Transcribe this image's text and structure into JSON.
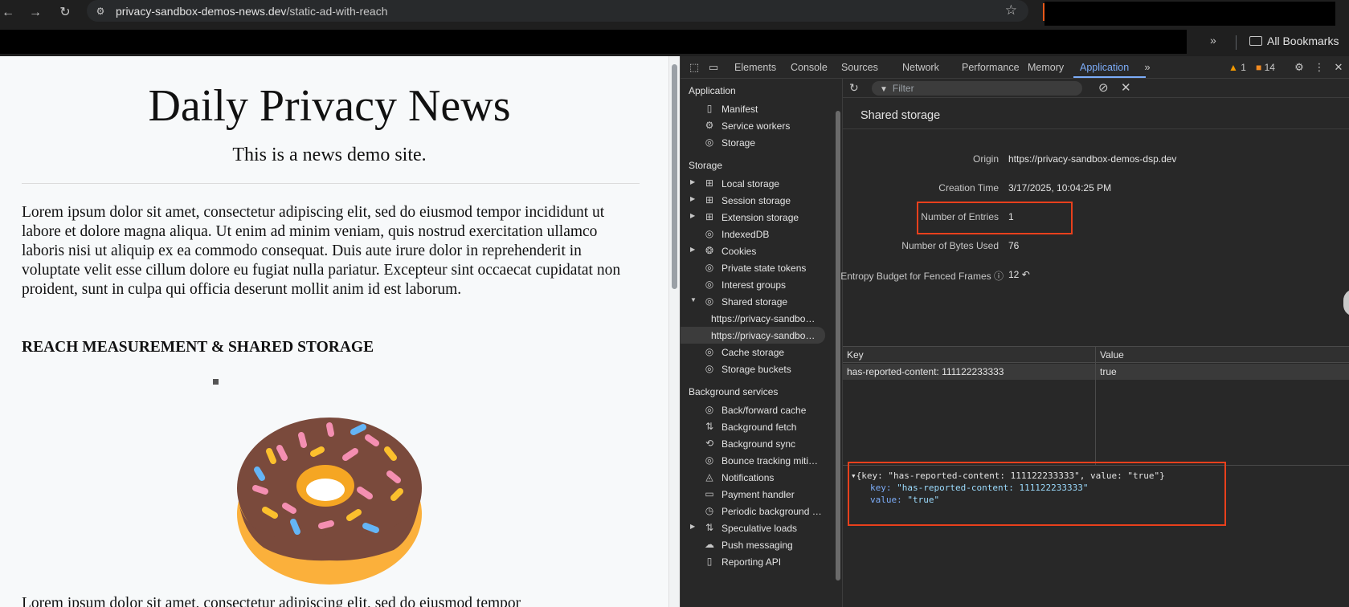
{
  "browser": {
    "url_host": "privacy-sandbox-demos-news.dev",
    "url_path": "/static-ad-with-reach",
    "bookmarks_all_label": "All Bookmarks",
    "nav_icons": [
      "back-icon",
      "forward-icon",
      "reload-icon",
      "site-info-icon",
      "bookmark-star-icon"
    ]
  },
  "page": {
    "title": "Daily Privacy News",
    "subtitle": "This is a news demo site.",
    "paragraph1": "Lorem ipsum dolor sit amet, consectetur adipiscing elit, sed do eiusmod tempor incididunt ut labore et dolore magna aliqua. Ut enim ad minim veniam, quis nostrud exercitation ullamco laboris nisi ut aliquip ex ea commodo consequat. Duis aute irure dolor in reprehenderit in voluptate velit esse cillum dolore eu fugiat nulla pariatur. Excepteur sint occaecat cupidatat non proident, sunt in culpa qui officia deserunt mollit anim id est laborum.",
    "section_heading": "REACH MEASUREMENT & SHARED STORAGE",
    "paragraph2": "Lorem ipsum dolor sit amet, consectetur adipiscing elit, sed do eiusmod tempor"
  },
  "devtools": {
    "tabs": [
      "Elements",
      "Console",
      "Sources",
      "Network",
      "Performance",
      "Memory",
      "Application"
    ],
    "active_tab": "Application",
    "warnings_count": "1",
    "issues_count": "14",
    "sidebar": {
      "sections": {
        "application": "Application",
        "storage": "Storage",
        "background_services": "Background services"
      },
      "application_items": [
        "Manifest",
        "Service workers",
        "Storage"
      ],
      "storage_items": [
        "Local storage",
        "Session storage",
        "Extension storage",
        "IndexedDB",
        "Cookies",
        "Private state tokens",
        "Interest groups",
        "Shared storage"
      ],
      "shared_storage_children": [
        "https://privacy-sandbo…",
        "https://privacy-sandbo…"
      ],
      "storage_items_after": [
        "Cache storage",
        "Storage buckets"
      ],
      "background_items": [
        "Back/forward cache",
        "Background fetch",
        "Background sync",
        "Bounce tracking miti…",
        "Notifications",
        "Payment handler",
        "Periodic background …",
        "Speculative loads",
        "Push messaging",
        "Reporting API"
      ]
    },
    "filter_placeholder": "Filter",
    "panel_title": "Shared storage",
    "metadata": {
      "origin_label": "Origin",
      "origin_value": "https://privacy-sandbox-demos-dsp.dev",
      "creation_label": "Creation Time",
      "creation_value": "3/17/2025, 10:04:25 PM",
      "entries_label": "Number of Entries",
      "entries_value": "1",
      "bytes_label": "Number of Bytes Used",
      "bytes_value": "76",
      "entropy_label": "Entropy Budget for Fenced Frames",
      "entropy_value": "12"
    },
    "grid": {
      "col_key": "Key",
      "col_value": "Value",
      "rows": [
        {
          "key": "has-reported-content: 111122233333",
          "value": "true"
        }
      ]
    },
    "preview": {
      "summary": "{key: \"has-reported-content: 111122233333\", value: \"true\"}",
      "key_label": "key:",
      "key_value": "\"has-reported-content: 111122233333\"",
      "value_label": "value:",
      "value_value": "\"true\""
    },
    "highlight_color": "#e8401c",
    "accent_color": "#7cacf8"
  }
}
